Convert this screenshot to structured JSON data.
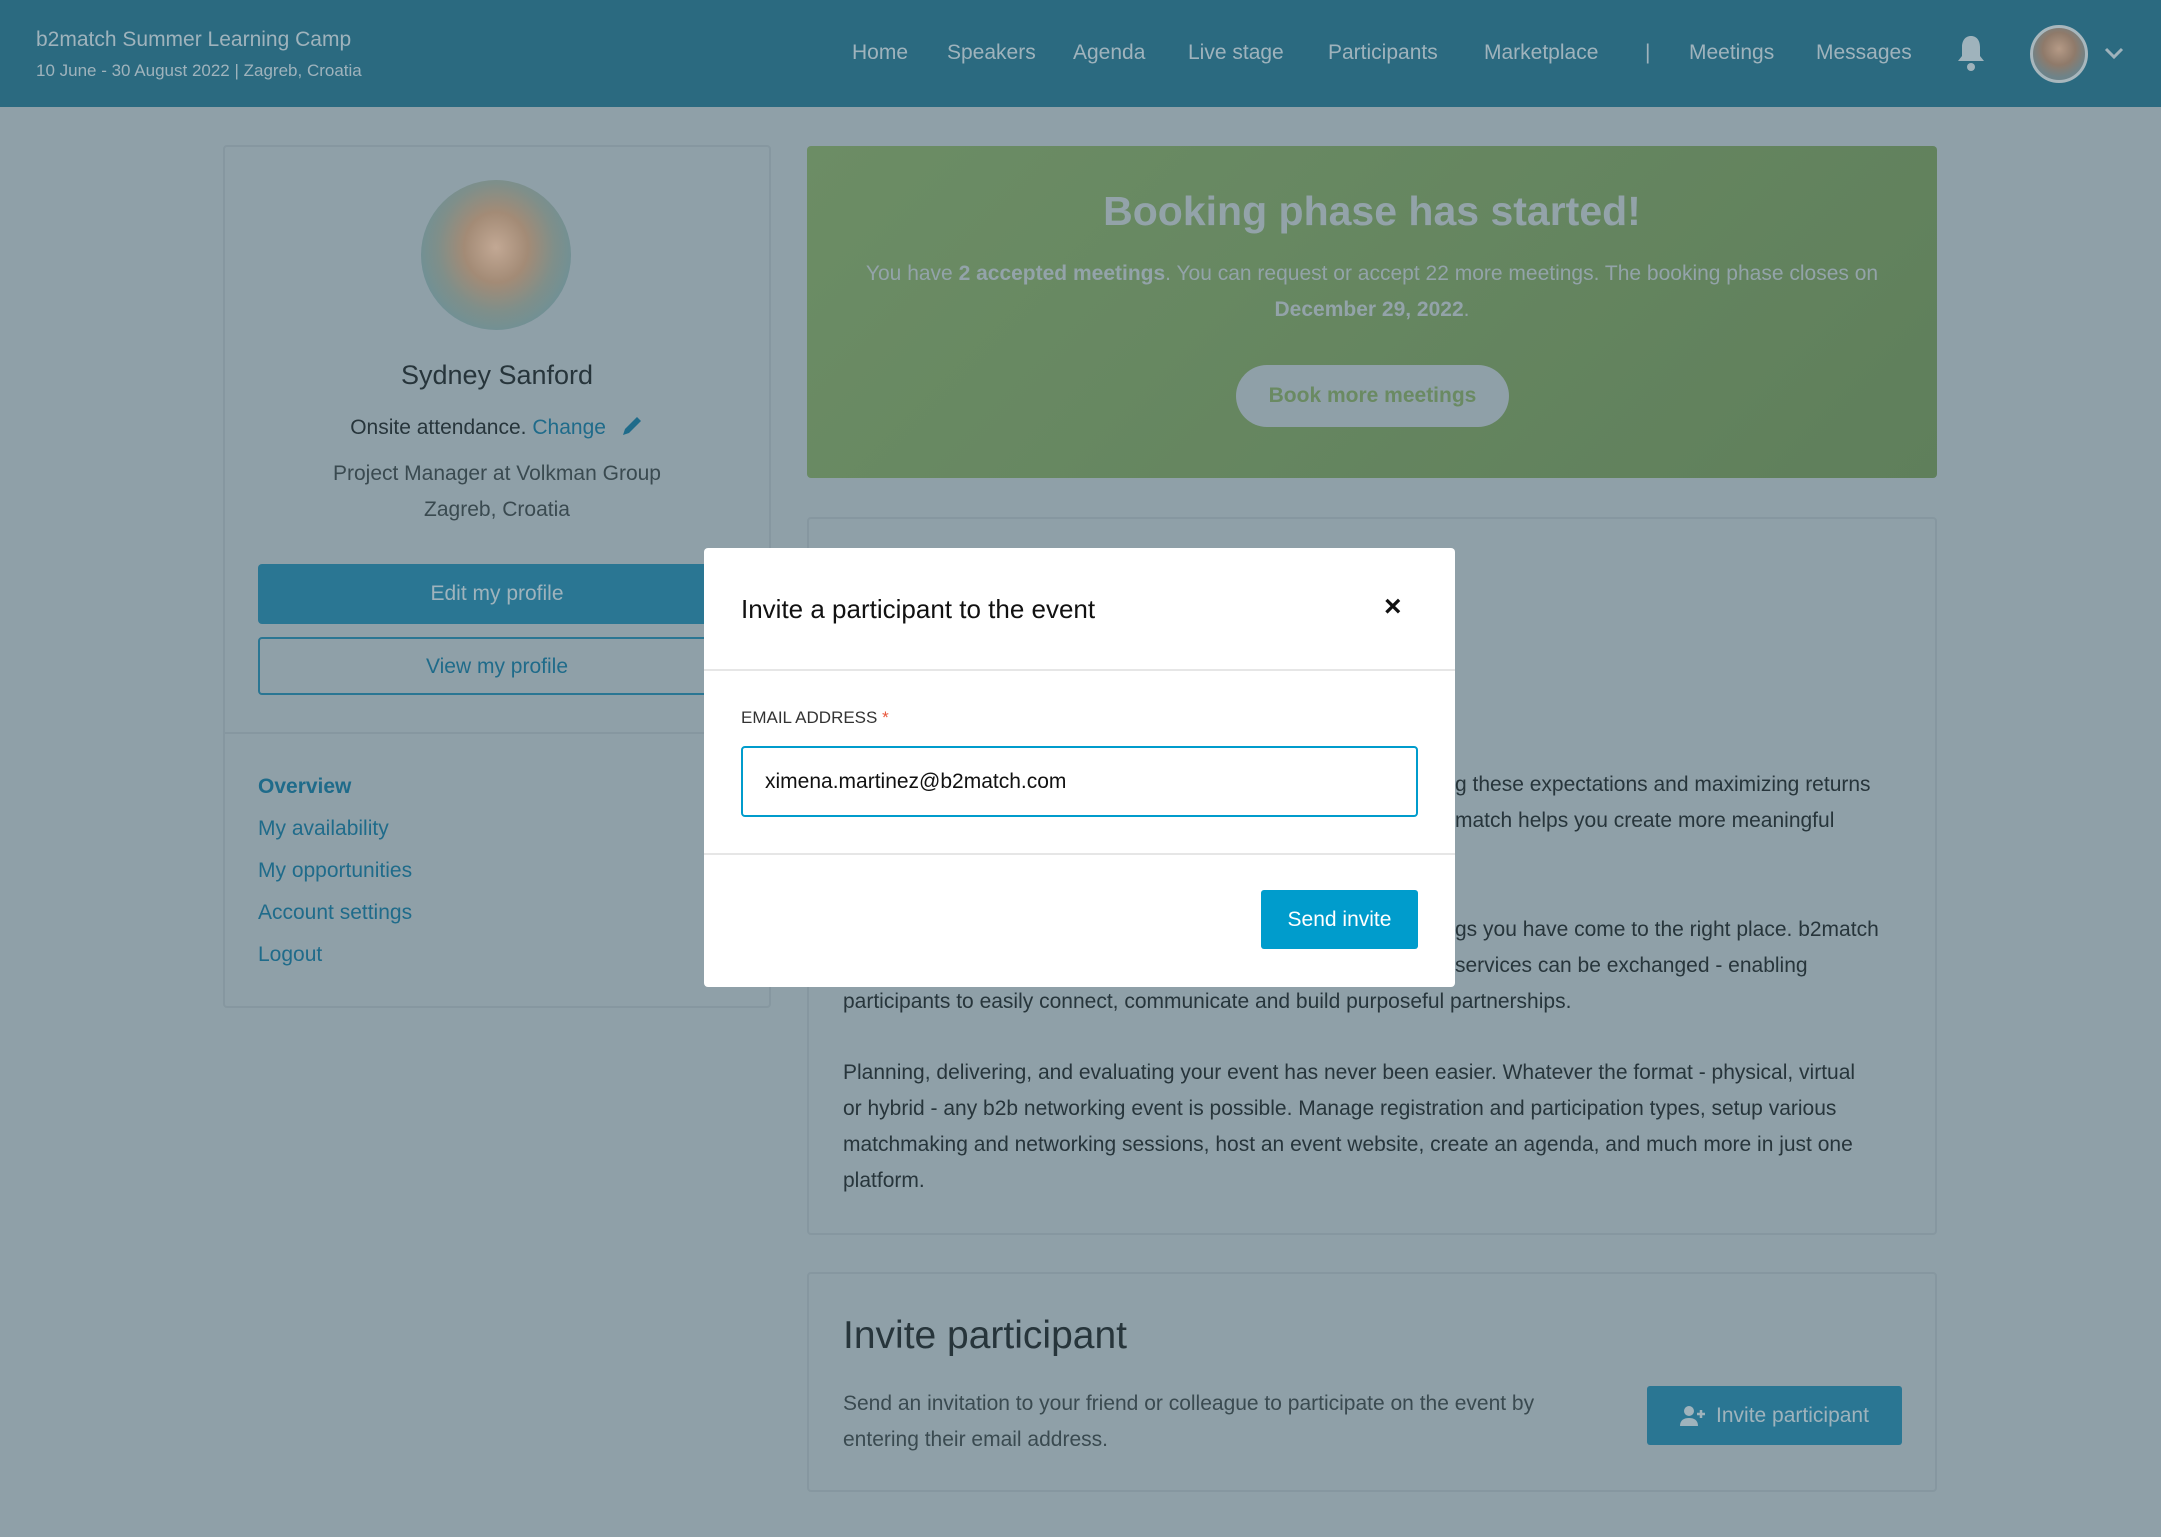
{
  "header": {
    "title": "b2match Summer Learning Camp",
    "subtitle": "10 June - 30 August 2022 | Zagreb, Croatia",
    "nav": [
      "Home",
      "Speakers",
      "Agenda",
      "Live stage",
      "Participants",
      "Marketplace",
      "|",
      "Meetings",
      "Messages"
    ]
  },
  "profile": {
    "name": "Sydney Sanford",
    "attendance": "Onsite attendance.",
    "change_label": "Change",
    "job": "Project Manager at Volkman Group",
    "location": "Zagreb, Croatia",
    "edit_label": "Edit my profile",
    "view_label": "View my profile",
    "menu": [
      "Overview",
      "My availability",
      "My opportunities",
      "Account settings",
      "Logout"
    ]
  },
  "banner": {
    "title": "Booking phase has started!",
    "text_1": "You have ",
    "text_bold": "2 accepted meetings",
    "text_2": ". You can request or accept 22 more meetings. The booking phase closes on",
    "date": "December 29, 2022",
    "date_suffix": ".",
    "button": "Book more meetings",
    "color": "#6a8a62"
  },
  "about": {
    "fragments": [
      "g these expectations and maximizing returns",
      "match helps you create more meaningful",
      "gs you have come to the right place. b2match",
      "services can be exchanged - enabling",
      "participants to easily connect, communicate and build purposeful partnerships."
    ],
    "paragraph3": [
      "Planning, delivering, and evaluating your event has never been easier. Whatever the format - physical, virtual",
      "or hybrid - any b2b networking event is possible. Manage registration and participation types, setup various",
      "matchmaking and networking sessions, host an event website, create an agenda, and much more in just one",
      "platform."
    ]
  },
  "invite": {
    "title": "Invite participant",
    "text": [
      "Send an invitation to your friend or colleague to participate on the event by",
      "entering their email address."
    ],
    "button": "Invite participant"
  },
  "modal": {
    "title": "Invite a participant to the event",
    "close": "×",
    "label": "EMAIL ADDRESS",
    "required": "*",
    "email_value": "ximena.martinez@b2match.com",
    "send": "Send invite",
    "accent": "#009ccc"
  }
}
